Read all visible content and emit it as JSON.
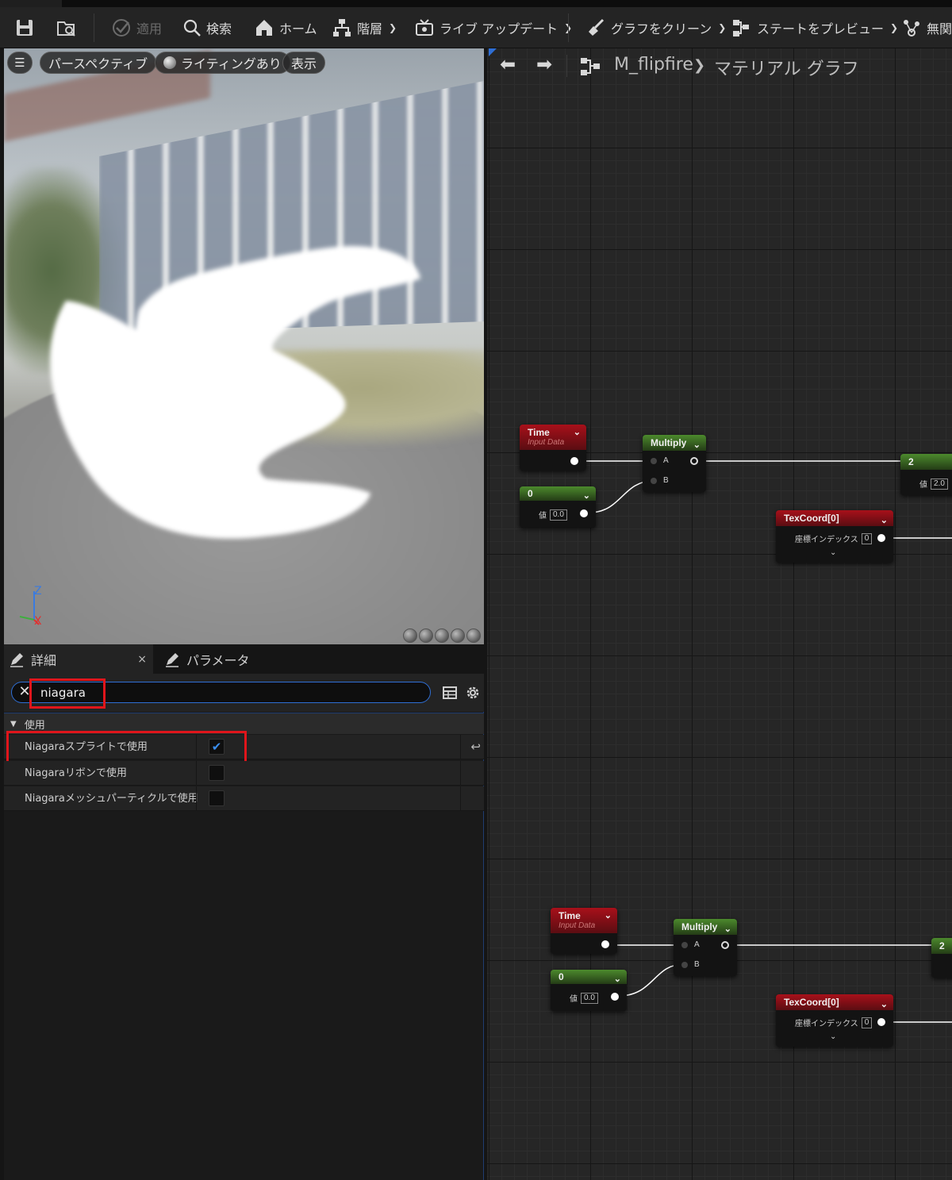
{
  "toolbar": {
    "apply": "適用",
    "search": "検索",
    "home": "ホーム",
    "hierarchy": "階層",
    "live_update": "ライブ アップデート",
    "clean_graph": "グラフをクリーン",
    "preview_state": "ステートをプレビュー",
    "more": "無関"
  },
  "viewport": {
    "menu_icon": "hamburger-icon",
    "perspective": "パースペクティブ",
    "lighting": "ライティングあり",
    "show": "表示",
    "axis_z": "Z",
    "axis_x": "X"
  },
  "details": {
    "tab_details": "詳細",
    "tab_close": "×",
    "tab_parameters": "パラメータ",
    "search_value": "niagara",
    "category": "使用",
    "properties": [
      {
        "label": "Niagaraスプライトで使用",
        "checked": true
      },
      {
        "label": "Niagaraリボンで使用",
        "checked": false
      },
      {
        "label": "Niagaraメッシュパーティクルで使用",
        "checked": false
      }
    ]
  },
  "graph": {
    "asset": "M_flipfire",
    "title": "マテリアル グラフ",
    "group1": {
      "time": {
        "title": "Time",
        "subtitle": "Input Data"
      },
      "multiply": {
        "title": "Multiply",
        "pin_a": "A",
        "pin_b": "B"
      },
      "const": {
        "title": "0",
        "label": "値",
        "value": "0.0"
      },
      "const2": {
        "title": "2",
        "label": "値",
        "value": "2.0"
      },
      "texcoord": {
        "title": "TexCoord[0]",
        "label": "座標インデックス",
        "value": "0"
      }
    },
    "group2": {
      "time": {
        "title": "Time",
        "subtitle": "Input Data"
      },
      "multiply": {
        "title": "Multiply",
        "pin_a": "A",
        "pin_b": "B"
      },
      "const": {
        "title": "0",
        "label": "値",
        "value": "0.0"
      },
      "const2": {
        "title": "2"
      },
      "texcoord": {
        "title": "TexCoord[0]",
        "label": "座標インデックス",
        "value": "0"
      }
    }
  },
  "colors": {
    "accent_blue": "#2f6fd6",
    "highlight_red": "#e0151b",
    "node_red": "#a8101a",
    "node_green": "#4c8a2d"
  }
}
